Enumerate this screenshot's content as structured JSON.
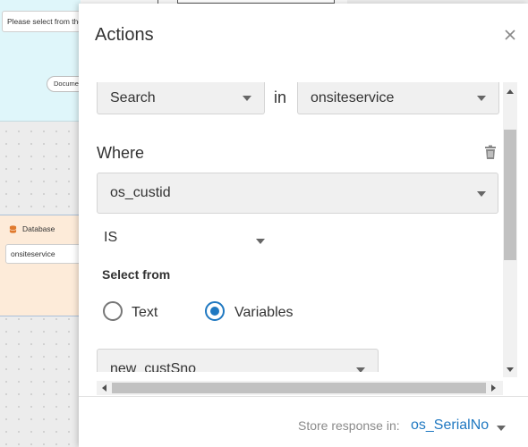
{
  "background": {
    "doc_card": {
      "hint": "Please select from the",
      "pill": "Documen"
    },
    "db_card": {
      "title": "Database",
      "table": "onsiteservice"
    }
  },
  "modal": {
    "title": "Actions",
    "query": {
      "action": "Search",
      "in_label": "in",
      "table": "onsiteservice"
    },
    "where": {
      "heading": "Where",
      "field": "os_custid",
      "operator": "IS",
      "select_from_label": "Select from",
      "options": [
        {
          "label": "Text",
          "selected": false
        },
        {
          "label": "Variables",
          "selected": true
        }
      ],
      "variable": "new_custSno"
    },
    "footer": {
      "store_label": "Store response in:",
      "store_value": "os_SerialNo"
    }
  },
  "colors": {
    "accent": "#1f78c1",
    "doc_card_bg": "#dff6fa",
    "db_card_bg": "#fdebd9"
  },
  "icons": [
    "close-icon",
    "trash-icon",
    "database-icon",
    "chevron-down-icon"
  ]
}
